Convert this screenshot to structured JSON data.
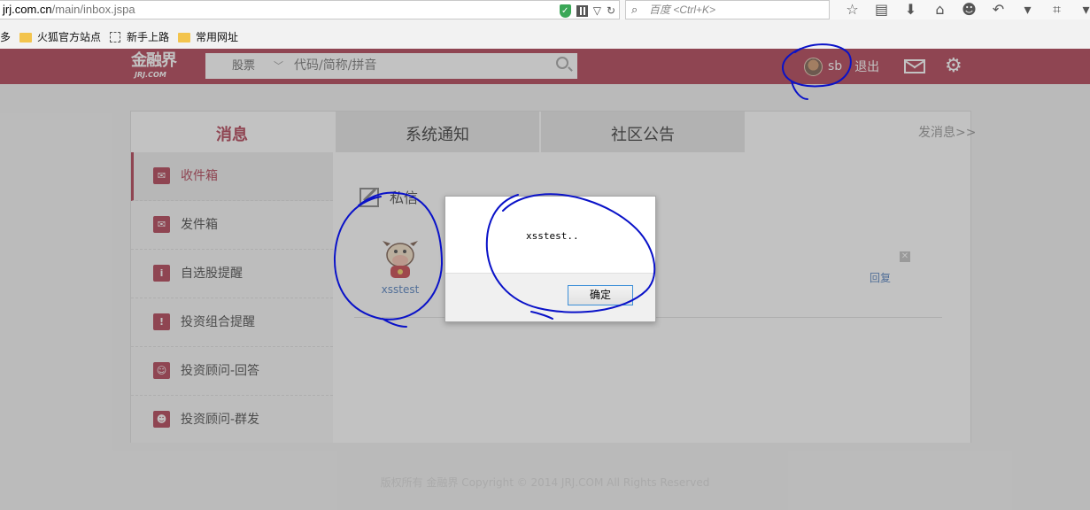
{
  "browser": {
    "url_domain": "jrj.com.cn",
    "url_path": "/main/inbox.jspa",
    "search_placeholder": "百度 <Ctrl+K>",
    "bookmarks": [
      {
        "label": "多"
      },
      {
        "label": "火狐官方站点"
      },
      {
        "label": "新手上路"
      },
      {
        "label": "常用网址"
      }
    ]
  },
  "header": {
    "logo_cn": "金融界",
    "logo_en": "JRJ.COM",
    "search_category": "股票",
    "search_placeholder": "代码/简称/拼音",
    "username": "sb",
    "logout_label": "退出"
  },
  "tabs": [
    {
      "label": "消息"
    },
    {
      "label": "系统通知"
    },
    {
      "label": "社区公告"
    }
  ],
  "send_message_label": "发消息>>",
  "sidebar": {
    "items": [
      {
        "label": "收件箱",
        "icon": "inbox-icon"
      },
      {
        "label": "发件箱",
        "icon": "outbox-icon"
      },
      {
        "label": "自选股提醒",
        "icon": "info-icon"
      },
      {
        "label": "投资组合提醒",
        "icon": "alert-icon"
      },
      {
        "label": "投资顾问-回答",
        "icon": "advisor-icon"
      },
      {
        "label": "投资顾问-群发",
        "icon": "group-icon"
      }
    ]
  },
  "content": {
    "section_title": "私信",
    "message": {
      "sender": "xsstest",
      "reply_label": "回复"
    }
  },
  "footer": {
    "text": "版权所有 金融界 Copyright © 2014 JRJ.COM All Rights Reserved"
  },
  "dialog": {
    "message": "xsstest..",
    "ok_label": "确定"
  },
  "colors": {
    "brand": "#a8293f",
    "link": "#3c6fb6",
    "annotation": "#0a12c8"
  }
}
